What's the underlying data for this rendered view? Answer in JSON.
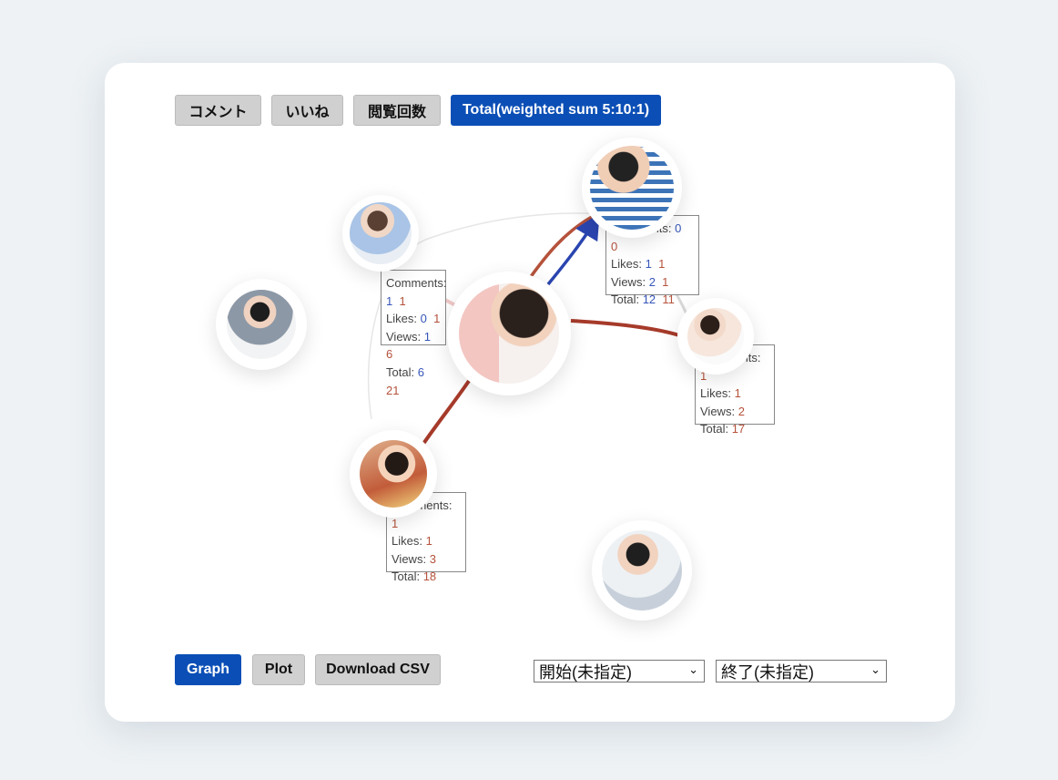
{
  "metric_tabs": [
    {
      "label": "コメント",
      "active": false
    },
    {
      "label": "いいね",
      "active": false
    },
    {
      "label": "閲覧回数",
      "active": false
    },
    {
      "label": "Total(weighted sum 5:10:1)",
      "active": true
    }
  ],
  "view_tabs": [
    {
      "label": "Graph",
      "active": true
    },
    {
      "label": "Plot",
      "active": false
    },
    {
      "label": "Download CSV",
      "active": false
    }
  ],
  "start_select": {
    "value": "開始(未指定)"
  },
  "end_select": {
    "value": "終了(未指定)"
  },
  "colors": {
    "accent": "#0b4fb6",
    "out_edge": "#a63a2a",
    "in_edge": "#2a45b0"
  },
  "labels": {
    "comments": "Comments:",
    "likes": "Likes:",
    "views": "Views:",
    "total": "Total:"
  },
  "nodes": [
    {
      "id": "woman-laptop",
      "stats": {
        "comments": [
          "1",
          "1"
        ],
        "likes": [
          "0",
          "1"
        ],
        "views": [
          "1",
          "6"
        ],
        "total": [
          "6",
          "21"
        ]
      }
    },
    {
      "id": "boy-striped",
      "stats": {
        "comments": [
          "0",
          "0"
        ],
        "likes": [
          "1",
          "1"
        ],
        "views": [
          "2",
          "1"
        ],
        "total": [
          "12",
          "11"
        ]
      }
    },
    {
      "id": "girl-tablet-center"
    },
    {
      "id": "boy-left"
    },
    {
      "id": "girl-right",
      "stats": {
        "comments": [
          "1"
        ],
        "likes": [
          "1"
        ],
        "views": [
          "2"
        ],
        "total": [
          "17"
        ]
      }
    },
    {
      "id": "girl-book",
      "stats": {
        "comments": [
          "1"
        ],
        "likes": [
          "1"
        ],
        "views": [
          "3"
        ],
        "total": [
          "18"
        ]
      }
    },
    {
      "id": "boys-tablet"
    }
  ]
}
